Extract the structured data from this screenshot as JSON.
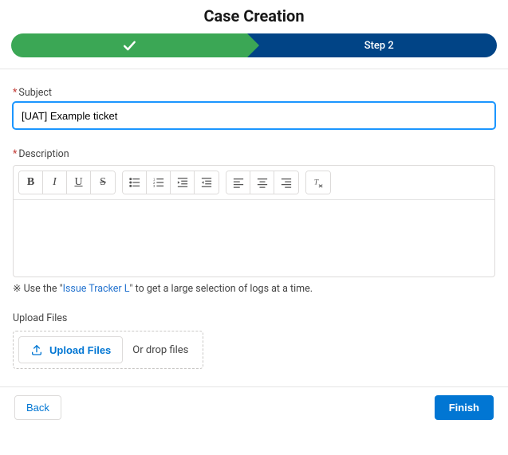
{
  "header": {
    "title": "Case Creation"
  },
  "stepper": {
    "step2_label": "Step 2"
  },
  "form": {
    "subject_label": "Subject",
    "subject_value": "[UAT] Example ticket",
    "description_label": "Description",
    "hint_prefix": "※ Use the \"",
    "hint_link": "Issue Tracker L",
    "hint_suffix": "\" to get a large selection of logs at a time."
  },
  "upload": {
    "section_label": "Upload Files",
    "button_label": "Upload Files",
    "drop_hint": "Or drop files"
  },
  "footer": {
    "back_label": "Back",
    "finish_label": "Finish"
  }
}
